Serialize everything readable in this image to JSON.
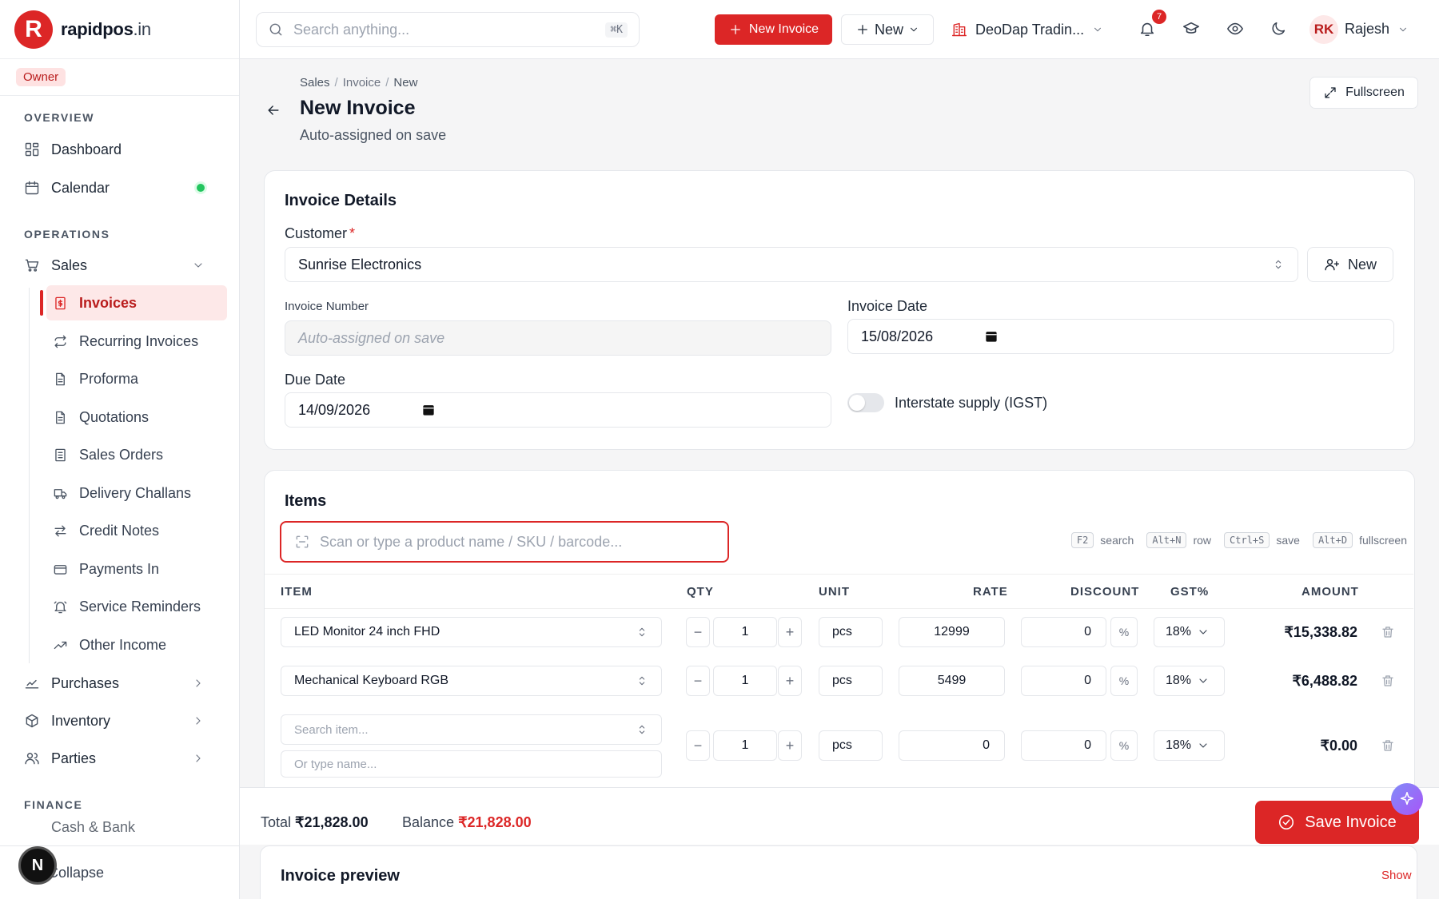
{
  "brand": {
    "name": "rapidpos",
    "tld": ".in",
    "logo_letter": "R",
    "accent": "#dc2626"
  },
  "role": "Owner",
  "sidebar": {
    "sections": [
      "OVERVIEW",
      "OPERATIONS",
      "FINANCE"
    ],
    "overview": [
      {
        "label": "Dashboard",
        "icon": "dashboard-icon"
      },
      {
        "label": "Calendar",
        "icon": "calendar-icon"
      }
    ],
    "sales": {
      "label": "Sales",
      "icon": "cart-icon",
      "expanded": true
    },
    "sales_items": [
      {
        "label": "Invoices",
        "icon": "invoice-icon",
        "active": true
      },
      {
        "label": "Recurring Invoices",
        "icon": "repeat-icon"
      },
      {
        "label": "Proforma",
        "icon": "file-icon"
      },
      {
        "label": "Quotations",
        "icon": "file-icon"
      },
      {
        "label": "Sales Orders",
        "icon": "list-icon"
      },
      {
        "label": "Delivery Challans",
        "icon": "truck-icon"
      },
      {
        "label": "Credit Notes",
        "icon": "swap-icon"
      },
      {
        "label": "Payments In",
        "icon": "card-icon"
      },
      {
        "label": "Service Reminders",
        "icon": "bell-icon"
      },
      {
        "label": "Other Income",
        "icon": "trend-icon"
      }
    ],
    "groups": [
      {
        "label": "Purchases",
        "icon": "chart-icon"
      },
      {
        "label": "Inventory",
        "icon": "box-icon"
      },
      {
        "label": "Parties",
        "icon": "users-icon"
      }
    ],
    "finance_partial": "Cash & Bank",
    "collapse": "Collapse",
    "n_badge": "N"
  },
  "header": {
    "search_placeholder": "Search anything...",
    "search_kbd": "⌘K",
    "new_invoice": "New Invoice",
    "new": "New",
    "company": "DeoDap Tradin...",
    "notifications": "7",
    "user_initials": "RK",
    "user_name": "Rajesh"
  },
  "page": {
    "breadcrumb": [
      "Sales",
      "Invoice",
      "New"
    ],
    "title": "New Invoice",
    "subtitle": "Auto-assigned on save",
    "fullscreen": "Fullscreen"
  },
  "details": {
    "title": "Invoice Details",
    "customer_label": "Customer",
    "customer_value": "Sunrise Electronics",
    "new_customer": "New",
    "invoice_number_label": "Invoice Number",
    "invoice_number_placeholder": "Auto-assigned on save",
    "invoice_date_label": "Invoice Date",
    "invoice_date": "15/08/2026",
    "due_date_label": "Due Date",
    "due_date": "14/09/2026",
    "interstate_label": "Interstate supply (IGST)",
    "interstate_on": false
  },
  "items": {
    "title": "Items",
    "scan_placeholder": "Scan or type a product name / SKU / barcode...",
    "shortcuts": [
      {
        "key": "F2",
        "label": "search"
      },
      {
        "key": "Alt+N",
        "label": "row"
      },
      {
        "key": "Ctrl+S",
        "label": "save"
      },
      {
        "key": "Alt+D",
        "label": "fullscreen"
      }
    ],
    "columns": [
      "ITEM",
      "QTY",
      "UNIT",
      "RATE",
      "DISCOUNT",
      "GST%",
      "AMOUNT"
    ],
    "rows": [
      {
        "item": "LED Monitor 24 inch FHD",
        "qty": "1",
        "unit": "pcs",
        "rate": "12999",
        "discount": "0",
        "discount_unit": "%",
        "gst": "18%",
        "amount": "₹15,338.82"
      },
      {
        "item": "Mechanical Keyboard RGB",
        "qty": "1",
        "unit": "pcs",
        "rate": "5499",
        "discount": "0",
        "discount_unit": "%",
        "gst": "18%",
        "amount": "₹6,488.82"
      },
      {
        "item_placeholder": "Search item...",
        "name_placeholder": "Or type name...",
        "qty": "1",
        "unit": "pcs",
        "rate": "0",
        "discount": "0",
        "discount_unit": "%",
        "gst": "18%",
        "amount": "₹0.00"
      }
    ],
    "minus": "−",
    "plus": "+"
  },
  "footer": {
    "total_label": "Total",
    "total": "₹21,828.00",
    "balance_label": "Balance",
    "balance": "₹21,828.00",
    "save": "Save Invoice",
    "preview_title": "Invoice preview",
    "preview_show": "Show"
  }
}
